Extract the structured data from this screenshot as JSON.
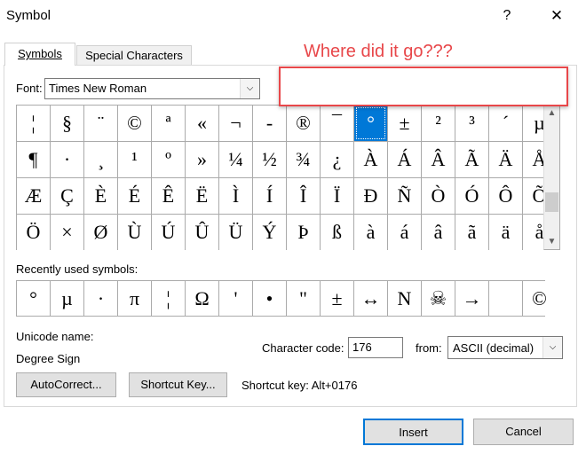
{
  "window": {
    "title": "Symbol",
    "help_label": "?",
    "close_label": "✕"
  },
  "tabs": [
    {
      "label": "Symbols",
      "active": true
    },
    {
      "label": "Special Characters",
      "active": false
    }
  ],
  "annotation": {
    "text": "Where did it go???",
    "color": "#e8474a"
  },
  "font": {
    "label": "Font:",
    "value": "Times New Roman"
  },
  "symbol_grid": {
    "selected_index": 10,
    "selection_color": "#0078d7",
    "rows": [
      [
        "¦",
        "§",
        "¨",
        "©",
        "ª",
        "«",
        "¬",
        "-",
        "®",
        "¯",
        "°",
        "±",
        "²",
        "³",
        "´",
        "µ"
      ],
      [
        "¶",
        "·",
        "¸",
        "¹",
        "º",
        "»",
        "¼",
        "½",
        "¾",
        "¿",
        "À",
        "Á",
        "Â",
        "Ã",
        "Ä",
        "Å"
      ],
      [
        "Æ",
        "Ç",
        "È",
        "É",
        "Ê",
        "Ë",
        "Ì",
        "Í",
        "Î",
        "Ï",
        "Ð",
        "Ñ",
        "Ò",
        "Ó",
        "Ô",
        "Õ"
      ],
      [
        "Ö",
        "×",
        "Ø",
        "Ù",
        "Ú",
        "Û",
        "Ü",
        "Ý",
        "Þ",
        "ß",
        "à",
        "á",
        "â",
        "ã",
        "ä",
        "å"
      ]
    ]
  },
  "recent": {
    "label": "Recently used symbols:",
    "symbols": [
      "°",
      "µ",
      "·",
      "π",
      "¦",
      "Ω",
      "'",
      "•",
      "\"",
      "±",
      "↔",
      "N",
      "☠",
      "→",
      "",
      "©"
    ]
  },
  "unicode": {
    "label": "Unicode name:",
    "value": "Degree Sign"
  },
  "character_code": {
    "label": "Character code:",
    "value": "176"
  },
  "from": {
    "label": "from:",
    "value": "ASCII (decimal)"
  },
  "buttons": {
    "autocorrect": "AutoCorrect...",
    "shortcut_key": "Shortcut Key...",
    "insert": "Insert",
    "cancel": "Cancel"
  },
  "shortcut_text": "Shortcut key: Alt+0176"
}
